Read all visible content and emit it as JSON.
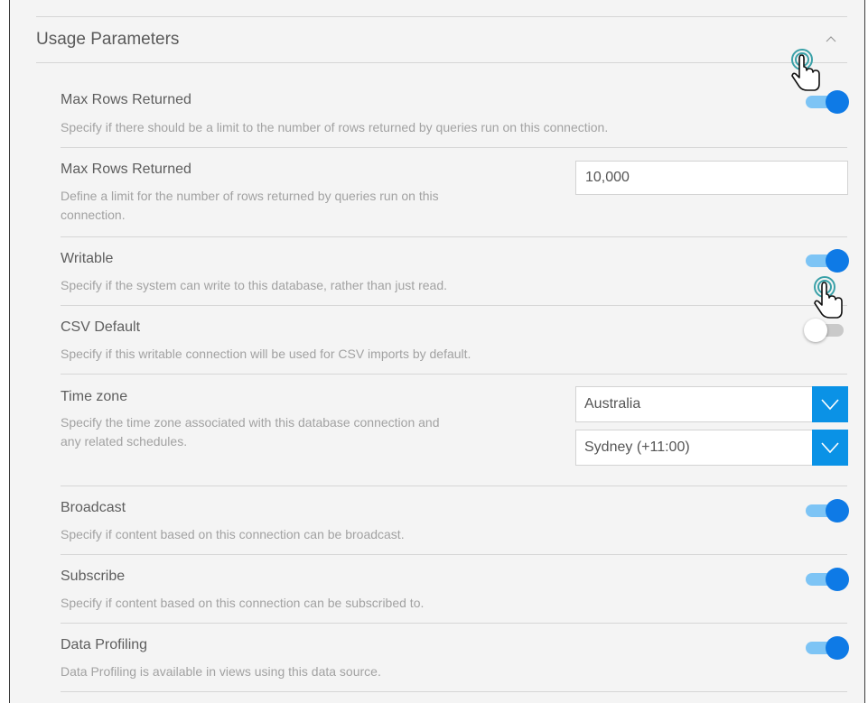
{
  "section": {
    "title": "Usage Parameters",
    "collapse_icon": "chevron-up-icon"
  },
  "rows": {
    "max_rows_toggle": {
      "title": "Max Rows Returned",
      "desc": "Specify if there should be a limit to the number of rows returned by queries run on this connection.",
      "enabled": true
    },
    "max_rows_limit": {
      "title": "Max Rows Returned",
      "desc_line1": "Define a limit for the number of rows returned by queries run on this",
      "desc_line2": "connection.",
      "value": "10,000"
    },
    "writable": {
      "title": "Writable",
      "desc": "Specify if the system can write to this database, rather than just read.",
      "enabled": true
    },
    "csv_default": {
      "title": "CSV Default",
      "desc": "Specify if this writable connection will be used for CSV imports by default.",
      "enabled": false
    },
    "time_zone": {
      "title": "Time zone",
      "desc_line1": "Specify the time zone associated with this database connection and",
      "desc_line2": "any related schedules.",
      "region": "Australia",
      "zone": "Sydney (+11:00)"
    },
    "broadcast": {
      "title": "Broadcast",
      "desc": "Specify if content based on this connection can be broadcast.",
      "enabled": true
    },
    "subscribe": {
      "title": "Subscribe",
      "desc": "Specify if content based on this connection can be subscribed to.",
      "enabled": true
    },
    "data_profiling": {
      "title": "Data Profiling",
      "desc": "Data Profiling is available in views using this data source.",
      "enabled": true
    }
  },
  "colors": {
    "accent": "#0e7ae6",
    "toggle_track_on": "#7dc4f5",
    "select_button": "#0a92e6",
    "panel_bg": "#f4f4f4"
  },
  "icons": {
    "cursor": "hand-pointer-click-icon",
    "select_arrow": "chevron-down-icon"
  }
}
